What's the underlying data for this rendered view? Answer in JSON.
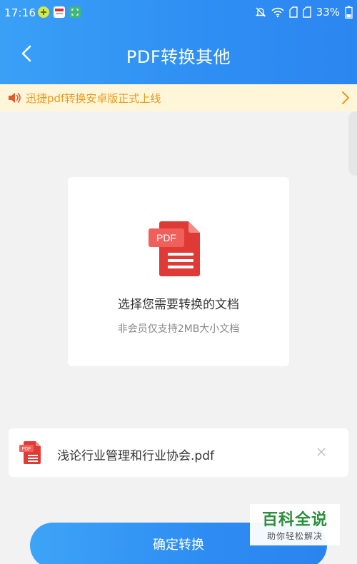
{
  "status_bar": {
    "time": "17:16",
    "battery": "33%"
  },
  "header": {
    "title": "PDF转换其他"
  },
  "notice": {
    "text": "迅捷pdf转换安卓版正式上线"
  },
  "upload": {
    "icon_label": "PDF",
    "title": "选择您需要转换的文档",
    "subtitle": "非会员仅支持2MB大小文档"
  },
  "file": {
    "icon_label": "PDF",
    "name": "浅论行业管理和行业协会.pdf"
  },
  "actions": {
    "confirm_label": "确定转换"
  },
  "watermark": {
    "main": "百科全说",
    "sub": "助你轻松解决"
  },
  "colors": {
    "header_blue": "#2f8ff3",
    "notice_bg": "#fff6d9",
    "notice_text": "#e79a1a",
    "pdf_red": "#e03a36",
    "watermark_green": "#2a8f3a"
  },
  "icons": [
    "back-arrow-icon",
    "speaker-icon",
    "chevron-right-icon",
    "pdf-file-icon",
    "close-icon",
    "wifi-icon",
    "mute-icon",
    "battery-icon"
  ]
}
